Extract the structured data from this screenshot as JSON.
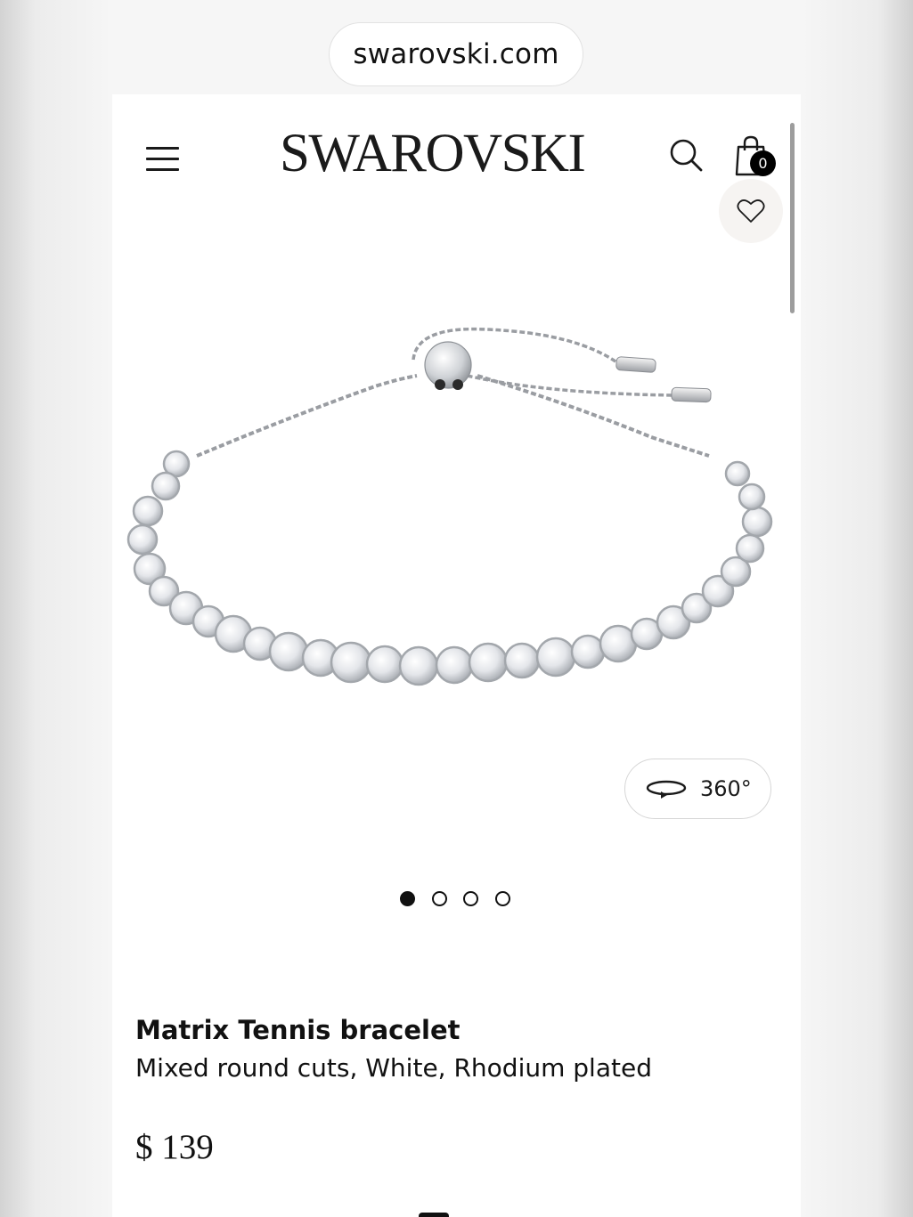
{
  "browser": {
    "url": "swarovski.com"
  },
  "header": {
    "brand": "SWAROVSKI",
    "cart_count": "0"
  },
  "icons": {
    "menu": "hamburger-menu-icon",
    "search": "search-icon",
    "bag": "shopping-bag-icon",
    "wishlist": "heart-icon",
    "rotate": "rotate-360-icon"
  },
  "gallery": {
    "view360_label": "360°",
    "slide_count": 4,
    "active_slide": 1
  },
  "product": {
    "name": "Matrix Tennis bracelet",
    "description": "Mixed round cuts, White, Rhodium plated",
    "price": "$ 139"
  },
  "colors": {
    "text": "#111111",
    "badge_bg": "#000000",
    "wishlist_bg": "#f6f4f2"
  }
}
